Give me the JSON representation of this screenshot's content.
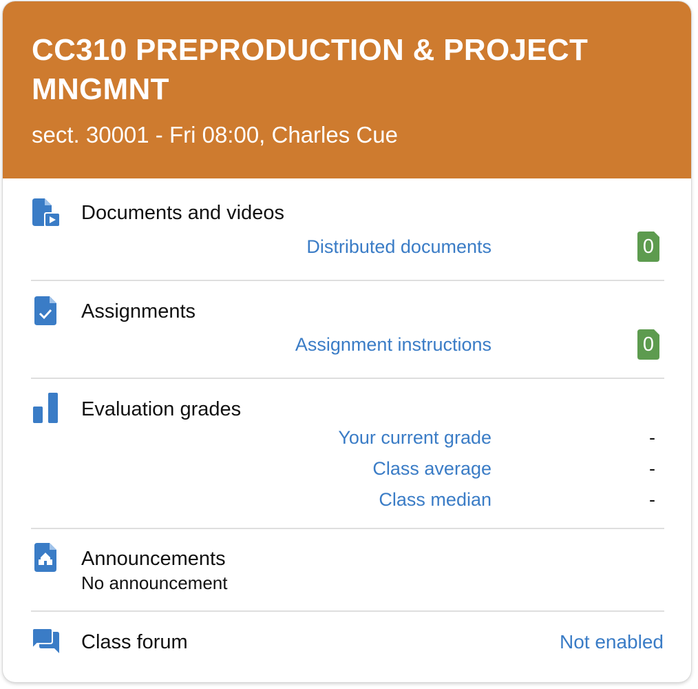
{
  "course": {
    "title": "CC310 PREPRODUCTION & PROJECT MNGMNT",
    "subtitle": "sect. 30001 - Fri 08:00, Charles Cue",
    "header_color": "#ce7b2f"
  },
  "documents": {
    "icon": "document-video-icon",
    "title": "Documents and videos",
    "link": "Distributed documents",
    "count": "0"
  },
  "assignments": {
    "icon": "document-check-icon",
    "title": "Assignments",
    "link": "Assignment instructions",
    "count": "0"
  },
  "grades": {
    "icon": "bar-chart-icon",
    "title": "Evaluation grades",
    "rows": [
      {
        "label": "Your current grade",
        "value": "-"
      },
      {
        "label": "Class average",
        "value": "-"
      },
      {
        "label": "Class median",
        "value": "-"
      }
    ]
  },
  "announcements": {
    "icon": "announcement-icon",
    "title": "Announcements",
    "text": "No announcement"
  },
  "forum": {
    "icon": "chat-bubbles-icon",
    "title": "Class forum",
    "status": "Not enabled"
  },
  "colors": {
    "link": "#3a7cc6",
    "icon": "#3a7cc6",
    "badge": "#5d9b4f"
  }
}
